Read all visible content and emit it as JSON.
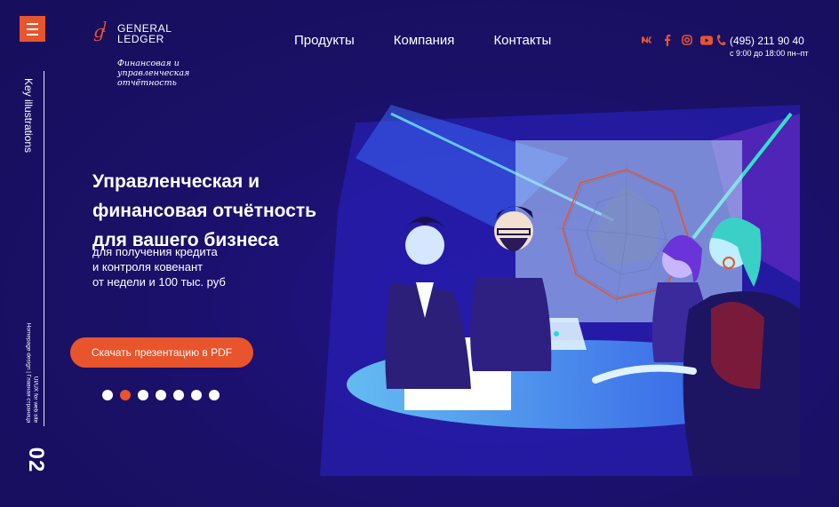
{
  "brand": {
    "name_line1": "GENERAL",
    "name_line2": "LEDGER",
    "tagline": "Финансовая и управленческая отчётность",
    "accent_color": "#e8542c",
    "background_color": "#1a1066"
  },
  "menu": {
    "icon": "hamburger-icon"
  },
  "nav": {
    "items": [
      {
        "label": "Продукты"
      },
      {
        "label": "Компания"
      },
      {
        "label": "Контакты"
      }
    ]
  },
  "socials": [
    "vk-icon",
    "facebook-icon",
    "instagram-icon",
    "youtube-icon"
  ],
  "contact": {
    "phone": "(495) 211 90 40",
    "hours": "с 9:00 до 18:00 пн–пт"
  },
  "side": {
    "label": "Key illustrations",
    "small_line1": "Homepage design | Главная страница",
    "small_line2": "UI/UX for web site",
    "slide_number": "02"
  },
  "hero": {
    "title_line1": "Управленческая и",
    "title_line2": "финансовая отчётность",
    "title_line3": "для вашего бизнеса",
    "sub_line1": "для получения кредита",
    "sub_line2": "и контроля ковенант",
    "sub_line3": "от недели и 100 тыс. руб",
    "cta": "Скачать презентацию в PDF"
  },
  "slider": {
    "count": 7,
    "active_index": 1
  }
}
